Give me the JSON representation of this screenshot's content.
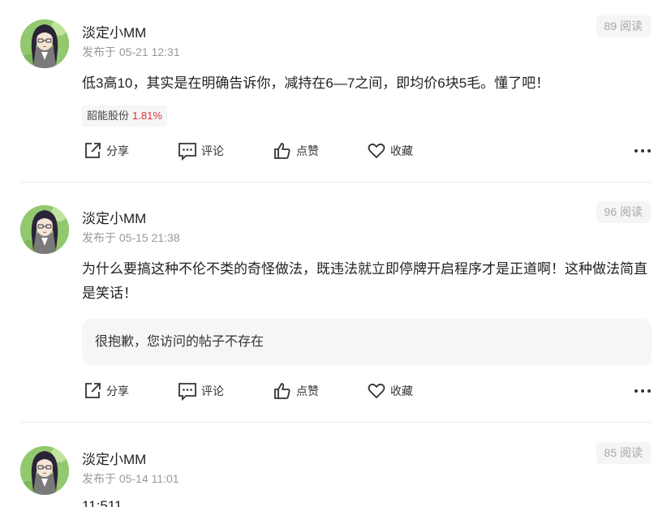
{
  "posts": [
    {
      "author": "淡定小MM",
      "date": "发布于 05-21 12:31",
      "reads": "89 阅读",
      "content": "低3高10，其实是在明确告诉你，减持在6—7之间，即均价6块5毛。懂了吧！",
      "stock": {
        "name": "韶能股份",
        "change": "1.81%",
        "change_color": "#e0312f"
      },
      "actions": {
        "share": "分享",
        "comment": "评论",
        "like": "点赞",
        "favorite": "收藏"
      }
    },
    {
      "author": "淡定小MM",
      "date": "发布于 05-15 21:38",
      "reads": "96 阅读",
      "content": "为什么要搞这种不伦不类的奇怪做法，既违法就立即停牌开启程序才是正道啊！这种做法简直是笑话！",
      "quote": "很抱歉，您访问的帖子不存在",
      "actions": {
        "share": "分享",
        "comment": "评论",
        "like": "点赞",
        "favorite": "收藏"
      }
    },
    {
      "author": "淡定小MM",
      "date": "发布于 05-14 11:01",
      "reads": "85 阅读",
      "content_partial": "11:511"
    }
  ],
  "icons": {
    "share": "share-icon",
    "comment": "comment-icon",
    "like": "thumbs-up-icon",
    "favorite": "heart-icon",
    "more": "more-dots-icon",
    "avatar": "avatar-illustration"
  },
  "colors": {
    "text": "#222222",
    "muted": "#999999",
    "stock_up": "#e0312f",
    "tag_bg": "#f5f6f8",
    "divider": "#ececec"
  }
}
